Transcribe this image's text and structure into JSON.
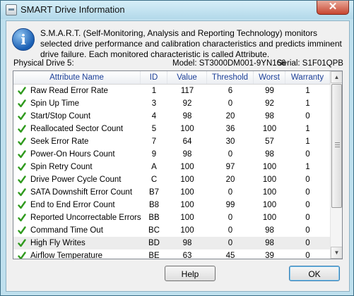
{
  "window": {
    "title": "SMART Drive Information",
    "close_glyph": "✕"
  },
  "info": {
    "icon_glyph": "i",
    "text": "S.M.A.R.T. (Self-Monitoring, Analysis and Reporting Technology) monitors selected drive performance and calibration characteristics and predicts imminent drive failure. Each monitored characteristic is called Attribute."
  },
  "drive": {
    "physical": "Physical Drive 5:",
    "model": "Model: ST3000DM001-9YN166",
    "serial": "Serial: S1F01QPB"
  },
  "table": {
    "headers": [
      "Attribute Name",
      "ID",
      "Value",
      "Threshold",
      "Worst",
      "Warranty"
    ],
    "rows": [
      [
        "Raw Read Error Rate",
        "1",
        "117",
        "6",
        "99",
        "1"
      ],
      [
        "Spin Up Time",
        "3",
        "92",
        "0",
        "92",
        "1"
      ],
      [
        "Start/Stop Count",
        "4",
        "98",
        "20",
        "98",
        "0"
      ],
      [
        "Reallocated Sector Count",
        "5",
        "100",
        "36",
        "100",
        "1"
      ],
      [
        "Seek Error Rate",
        "7",
        "64",
        "30",
        "57",
        "1"
      ],
      [
        "Power-On Hours Count",
        "9",
        "98",
        "0",
        "98",
        "0"
      ],
      [
        "Spin Retry Count",
        "A",
        "100",
        "97",
        "100",
        "1"
      ],
      [
        "Drive Power Cycle Count",
        "C",
        "100",
        "20",
        "100",
        "0"
      ],
      [
        "SATA Downshift Error Count",
        "B7",
        "100",
        "0",
        "100",
        "0"
      ],
      [
        "End to End Error Count",
        "B8",
        "100",
        "99",
        "100",
        "0"
      ],
      [
        "Reported Uncorrectable Errors",
        "BB",
        "100",
        "0",
        "100",
        "0"
      ],
      [
        "Command Time Out",
        "BC",
        "100",
        "0",
        "98",
        "0"
      ],
      [
        "High Fly Writes",
        "BD",
        "98",
        "0",
        "98",
        "0"
      ],
      [
        "Airflow Temperature",
        "BE",
        "63",
        "45",
        "39",
        "0"
      ]
    ],
    "selected_row": 12,
    "status_icon": "green-check-icon",
    "check_color": "#2f9a1d"
  },
  "buttons": {
    "help": "Help",
    "ok": "OK"
  }
}
